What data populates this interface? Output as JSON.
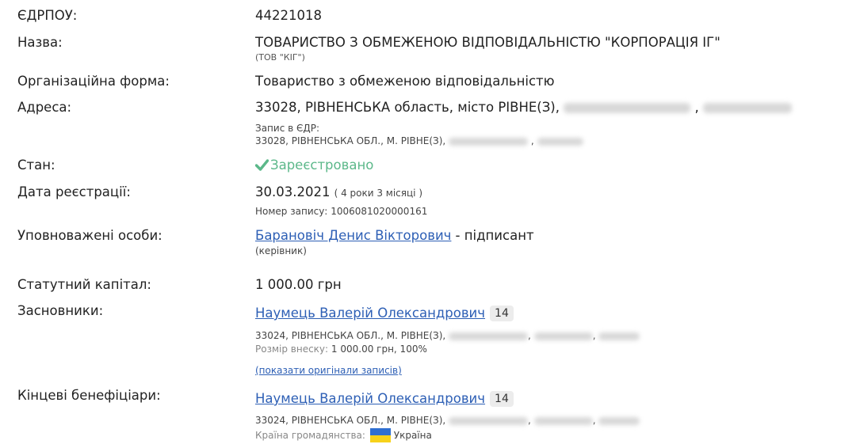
{
  "edrpou": {
    "label": "ЄДРПОУ:",
    "value": "44221018"
  },
  "name": {
    "label": "Назва:",
    "full": "ТОВАРИСТВО З ОБМЕЖЕНОЮ ВІДПОВІДАЛЬНІСТЮ \"КОРПОРАЦІЯ ІГ\"",
    "short": "(ТОВ \"КІГ\")"
  },
  "org_form": {
    "label": "Організаційна форма:",
    "value": "Товариство з обмеженою відповідальністю"
  },
  "address": {
    "label": "Адреса:",
    "value": "33028, РІВНЕНСЬКА область, місто РІВНЕ(З),",
    "comma": ",",
    "edr_caption": "Запис в ЄДР:",
    "edr_value": "33028, РІВНЕНСЬКА ОБЛ., М. РІВНЕ(З),",
    "edr_comma": ","
  },
  "status": {
    "label": "Стан:",
    "value": "Зареєстровано",
    "icon": "check-icon",
    "color": "#5cb88a"
  },
  "registration": {
    "label": "Дата реєстрації:",
    "date": "30.03.2021",
    "age": "( 4 роки 3 місяці )",
    "record_caption": "Номер запису:",
    "record_number": "1006081020000161"
  },
  "authorized": {
    "label": "Уповноважені особи:",
    "person": "Барановіч Денис Вікторович",
    "role": "- підписант",
    "position": "(керівник)"
  },
  "capital": {
    "label": "Статутний капітал:",
    "value": "1 000.00 грн"
  },
  "founders": {
    "label": "Засновники:",
    "person": "Наумець Валерій Олександрович",
    "badge": "14",
    "address": "33024, РІВНЕНСЬКА ОБЛ., М. РІВНЕ(З),",
    "contribution_caption": "Розмір внеску:",
    "contribution_value": "1 000.00 грн, 100%",
    "show_original": "(показати оригінали записів)"
  },
  "beneficiaries": {
    "label": "Кінцеві бенефіціари:",
    "person": "Наумець Валерій Олександрович",
    "badge": "14",
    "address": "33024, РІВНЕНСЬКА ОБЛ., М. РІВНЕ(З),",
    "citizenship_caption": "Країна громадянства:",
    "citizenship_value": "Україна",
    "flag_colors": [
      "#2f6fd1",
      "#f7d21b"
    ]
  }
}
